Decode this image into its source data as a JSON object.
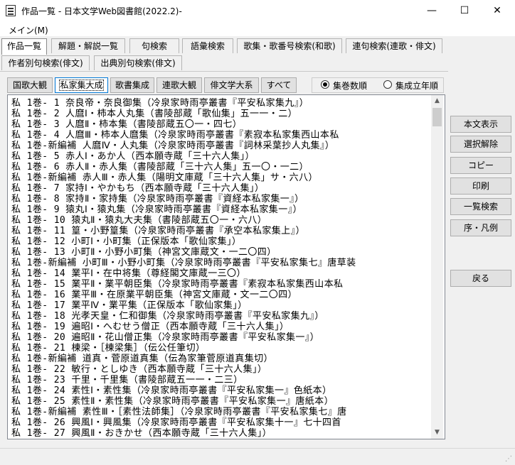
{
  "window": {
    "title": "作品一覧 - 日本文学Web図書館(2022.2)-",
    "minimize": "—",
    "maximize": "☐",
    "close": "✕"
  },
  "menu": {
    "main": "メイン(M)"
  },
  "tabs": [
    {
      "label": "作品一覧",
      "active": true
    },
    {
      "label": "解題・解説一覧"
    },
    {
      "label": "句検索"
    },
    {
      "label": "語彙検索"
    },
    {
      "label": "歌集・歌番号検索(和歌)"
    },
    {
      "label": "連句検索(連歌・俳文)"
    },
    {
      "label": "作者別句検索(俳文)"
    },
    {
      "label": "出典別句検索(俳文)"
    }
  ],
  "collections": [
    {
      "label": "国歌大観"
    },
    {
      "label": "私家集大成",
      "active": true
    },
    {
      "label": "歌書集成"
    },
    {
      "label": "連歌大観"
    },
    {
      "label": "俳文学大系"
    },
    {
      "label": "すべて"
    }
  ],
  "sort": {
    "option1": "集巻数順",
    "option2": "集成立年順",
    "selected": "集巻数順"
  },
  "list": {
    "rows": [
      "私 1巻-  1   奈良帝・奈良御集（冷泉家時雨亭叢書『平安私家集九』）",
      "私 1巻-  2   人麿Ⅰ・柿本人丸集（書陵部蔵「歌仙集」五一一・二）",
      "私 1巻-  3   人麿Ⅱ・柿本集（書陵部蔵五〇一・四七）",
      "私 1巻-  4   人麿Ⅲ・柿本人麿集（冷泉家時雨亭叢書『素寂本私家集西山本私",
      "私 1巻-新編補 人麿Ⅳ・人丸集（冷泉家時雨亭叢書『詞林采葉抄人丸集』）",
      "私 1巻-  5   赤人Ⅰ・あか人（西本願寺蔵「三十六人集」）",
      "私 1巻-  6   赤人Ⅱ・赤人集（書陵部蔵「三十六人集」五一〇・一二）",
      "私 1巻-新編補 赤人Ⅲ・赤人集（陽明文庫蔵「三十六人集」サ・六八）",
      "私 1巻-  7   家持Ⅰ・やかもち（西本願寺蔵「三十六人集」）",
      "私 1巻-  8   家持Ⅱ・家持集（冷泉家時雨亭叢書『資経本私家集一』）",
      "私 1巻-  9   猿丸Ⅰ・猿丸集（冷泉家時雨亭叢書『資経本私家集一』）",
      "私 1巻- 10   猿丸Ⅱ・猿丸大夫集（書陵部蔵五〇一・六八）",
      "私 1巻- 11   篁・小野篁集（冷泉家時雨亭叢書『承空本私家集上』）",
      "私 1巻- 12   小町Ⅰ・小町集（正保版本「歌仙家集」）",
      "私 1巻- 13   小町Ⅱ・小野小町集（神宮文庫蔵文・一二〇四）",
      "私 1巻-新編補 小町Ⅲ・小野小町集（冷泉家時雨亭叢書『平安私家集七』唐草装",
      "私 1巻- 14   業平Ⅰ・在中将集（尊経閣文庫蔵一三〇）",
      "私 1巻- 15   業平Ⅱ・業平朝臣集（冷泉家時雨亭叢書『素寂本私家集西山本私",
      "私 1巻- 16   業平Ⅲ・在原業平朝臣集（神宮文庫蔵・文一二〇四）",
      "私 1巻- 17   業平Ⅳ・業平集（正保版本「歌仙家集」）",
      "私 1巻- 18   光孝天皇・仁和御集（冷泉家時雨亭叢書『平安私家集九』）",
      "私 1巻- 19   遍昭Ⅰ・へむせう僧正（西本願寺蔵「三十六人集」）",
      "私 1巻- 20   遍昭Ⅱ・花山僧正集（冷泉家時雨亭叢書『平安私家集一』）",
      "私 1巻- 21   棟梁・［棟梁集］（伝公任筆切）",
      "私 1巻-新編補 道真・菅原道真集（伝為家筆菅原道真集切）",
      "私 1巻- 22   敏行・としゆき（西本願寺蔵「三十六人集」）",
      "私 1巻- 23   千里・千里集（書陵部蔵五一一・二三）",
      "私 1巻- 24   素性Ⅰ・素性集（冷泉家時雨亭叢書『平安私家集一』色紙本）",
      "私 1巻- 25   素性Ⅱ・素性集（冷泉家時雨亭叢書『平安私家集一』唐紙本）",
      "私 1巻-新編補 素性Ⅲ・［素性法師集］（冷泉家時雨亭叢書『平安私家集七』唐",
      "私 1巻- 26   興風Ⅰ・興風集（冷泉家時雨亭叢書『平安私家集十一』七十四首",
      "私 1巻- 27   興風Ⅱ・おきかせ（西本願寺蔵「三十六人集」）"
    ]
  },
  "buttons": {
    "show_text": "本文表示",
    "deselect": "選択解除",
    "copy": "コピー",
    "print": "印刷",
    "list_search": "一覧検索",
    "preface": "序・凡例",
    "back": "戻る"
  }
}
